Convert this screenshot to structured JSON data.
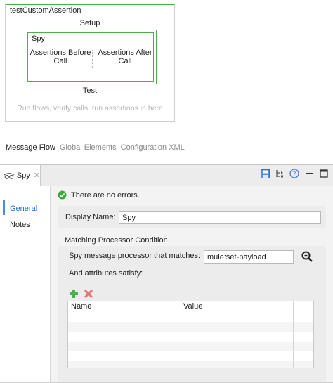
{
  "canvas": {
    "test_name": "testCustomAssertion",
    "setup_label": "Setup",
    "spy": {
      "title": "Spy",
      "before_label": "Assertions Before Call",
      "after_label": "Assertions After Call"
    },
    "test_label": "Test",
    "test_hint": "Run flows, verify calls, run assertions in here"
  },
  "editor_tabs": [
    {
      "label": "Message Flow"
    },
    {
      "label": "Global Elements"
    },
    {
      "label": "Configuration XML"
    }
  ],
  "view": {
    "tab_label": "Spy",
    "tab_icon": "spy-icon",
    "close_icon": "close-icon",
    "toolbar_icons": [
      "save-icon",
      "tree-icon",
      "help-icon",
      "minimize-icon",
      "maximize-icon"
    ]
  },
  "sidebar": {
    "items": [
      {
        "label": "General"
      },
      {
        "label": "Notes"
      }
    ]
  },
  "status": {
    "message": "There are no errors.",
    "icon": "check-circle-icon"
  },
  "general": {
    "display_name_label": "Display Name:",
    "display_name_value": "Spy",
    "section_title": "Matching Processor Condition",
    "matcher_label": "Spy message processor that matches:",
    "matcher_value": "mule:set-payload",
    "attributes_label": "And attributes satisfy:",
    "table": {
      "columns": [
        "Name",
        "Value"
      ],
      "rows": []
    }
  },
  "colors": {
    "green": "#3bb54a",
    "selected_link": "#1b74c9",
    "hint_gray": "#b6b6b6"
  }
}
